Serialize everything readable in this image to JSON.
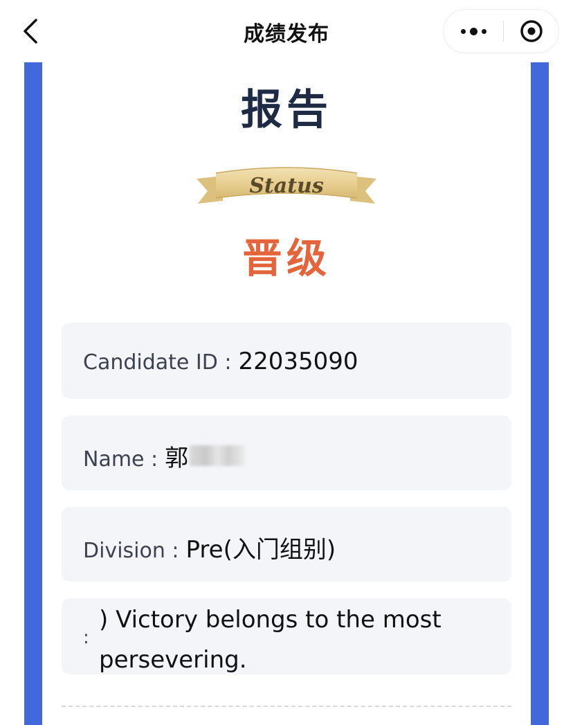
{
  "nav": {
    "title": "成绩发布"
  },
  "report": {
    "title": "报告",
    "ribbon_text": "Status",
    "status_value": "晋级"
  },
  "fields": {
    "candidate_id_label": "Candidate ID :",
    "candidate_id_value": "22035090",
    "name_label": "Name :",
    "name_value": "郭",
    "division_label": "Division :",
    "division_value": "Pre(入门组别)",
    "message_colon": ":",
    "message_text": ") Victory belongs to the most persevering."
  },
  "colors": {
    "side_bar": "#4169dc",
    "title_text": "#1f2a44",
    "status_text": "#e4653c",
    "box_background": "#f4f5f9",
    "ribbon_gold": "#e8cf92"
  },
  "icons": [
    "chevron-left-icon",
    "more-dots-icon",
    "mini-program-close-icon"
  ]
}
